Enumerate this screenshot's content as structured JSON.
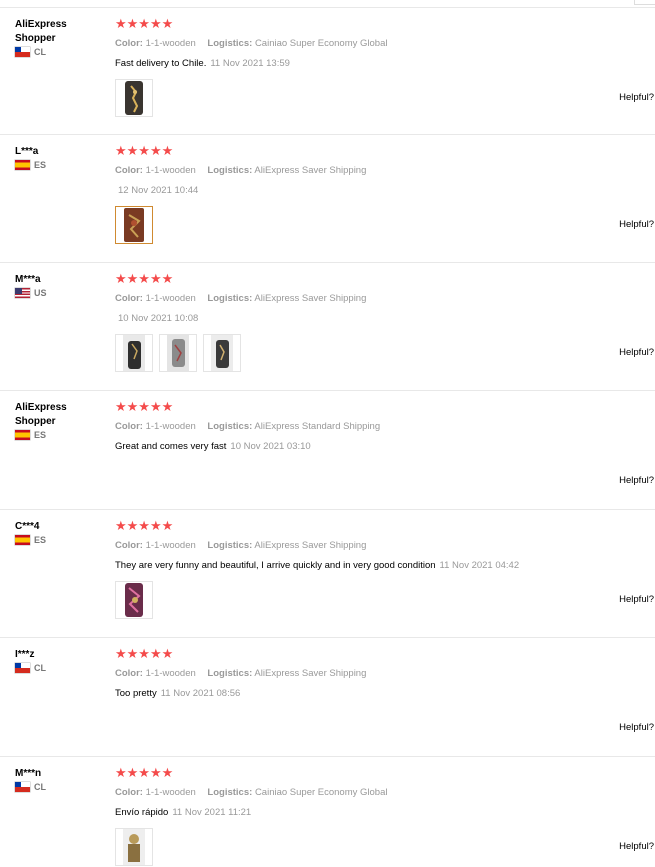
{
  "reviews": [
    {
      "user": "AliExpress Shopper",
      "country": "CL",
      "color_label": "Color:",
      "color": "1-1-wooden",
      "logistics_label": "Logistics:",
      "logistics": "Cainiao Super Economy Global",
      "text": "Fast delivery to Chile.",
      "date": "11 Nov 2021 13:59",
      "rating": 5,
      "images": 1,
      "helpful": "Helpful?"
    },
    {
      "user": "L***a",
      "country": "ES",
      "color_label": "Color:",
      "color": "1-1-wooden",
      "logistics_label": "Logistics:",
      "logistics": "AliExpress Saver Shipping",
      "text": "",
      "date": "12 Nov 2021 10:44",
      "rating": 5,
      "images": 1,
      "helpful": "Helpful?"
    },
    {
      "user": "M***a",
      "country": "US",
      "color_label": "Color:",
      "color": "1-1-wooden",
      "logistics_label": "Logistics:",
      "logistics": "AliExpress Saver Shipping",
      "text": "",
      "date": "10 Nov 2021 10:08",
      "rating": 5,
      "images": 3,
      "helpful": "Helpful?"
    },
    {
      "user": "AliExpress Shopper",
      "country": "ES",
      "color_label": "Color:",
      "color": "1-1-wooden",
      "logistics_label": "Logistics:",
      "logistics": "AliExpress Standard Shipping",
      "text": "Great and comes very fast",
      "date": "10 Nov 2021 03:10",
      "rating": 5,
      "images": 0,
      "helpful": "Helpful?"
    },
    {
      "user": "C***4",
      "country": "ES",
      "color_label": "Color:",
      "color": "1-1-wooden",
      "logistics_label": "Logistics:",
      "logistics": "AliExpress Saver Shipping",
      "text": "They are very funny and beautiful, I arrive quickly and in very good condition",
      "date": "11 Nov 2021 04:42",
      "rating": 5,
      "images": 1,
      "helpful": "Helpful?"
    },
    {
      "user": "I***z",
      "country": "CL",
      "color_label": "Color:",
      "color": "1-1-wooden",
      "logistics_label": "Logistics:",
      "logistics": "AliExpress Saver Shipping",
      "text": "Too pretty",
      "date": "11 Nov 2021 08:56",
      "rating": 5,
      "images": 0,
      "helpful": "Helpful?"
    },
    {
      "user": "M***n",
      "country": "CL",
      "color_label": "Color:",
      "color": "1-1-wooden",
      "logistics_label": "Logistics:",
      "logistics": "Cainiao Super Economy Global",
      "text": "Envío rápido",
      "date": "11 Nov 2021 11:21",
      "rating": 5,
      "images": 1,
      "helpful": "Helpful?"
    }
  ],
  "colors": {
    "star": "#f44b4b",
    "meta": "#999999",
    "selected_thumb": "#d08a30"
  }
}
